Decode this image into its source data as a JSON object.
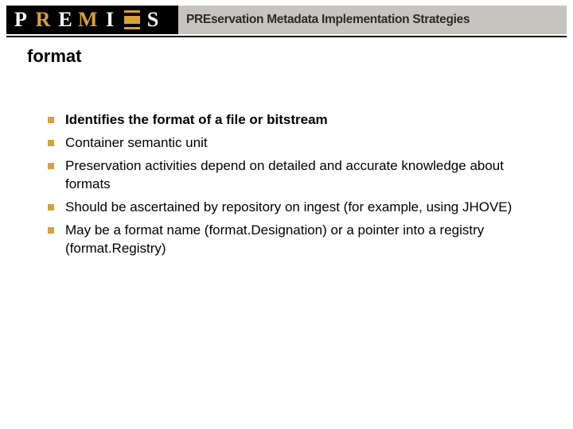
{
  "logo": {
    "letters": [
      "P",
      "R",
      "E",
      "M",
      "I",
      "S"
    ]
  },
  "header": {
    "title": "PREservation Metadata Implementation Strategies"
  },
  "slide": {
    "title": "format"
  },
  "bullets": [
    {
      "text": "Identifies the format of a file or bitstream",
      "bold": true
    },
    {
      "text": "Container semantic unit",
      "bold": false
    },
    {
      "text": "Preservation activities depend on detailed and accurate knowledge about formats",
      "bold": false
    },
    {
      "text": "Should be ascertained by repository on ingest (for example, using JHOVE)",
      "bold": false
    },
    {
      "text": "May be a format name (format.Designation) or a pointer into a registry (format.Registry)",
      "bold": false
    }
  ]
}
